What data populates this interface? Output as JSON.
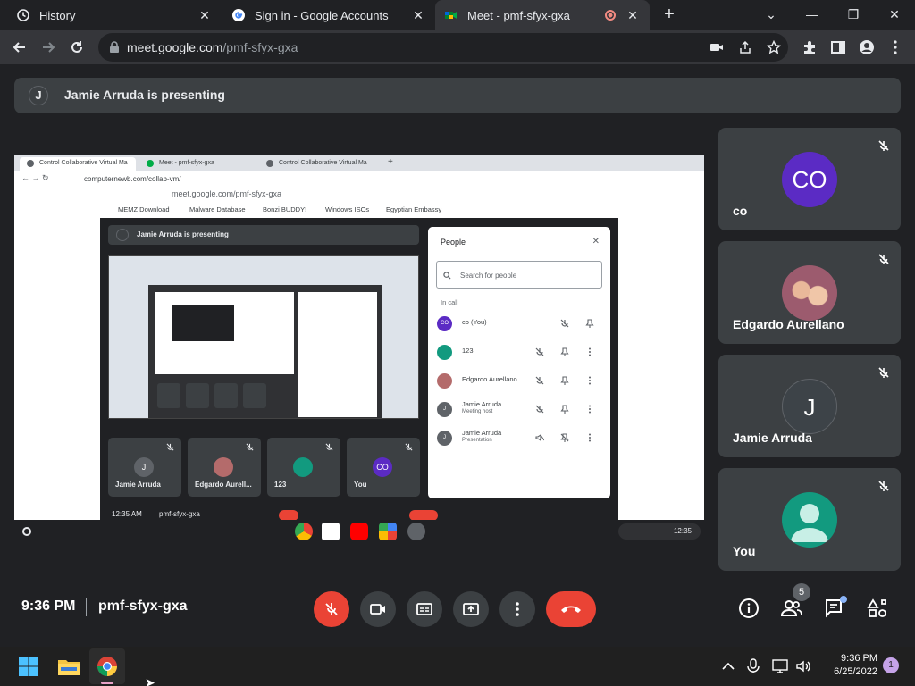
{
  "tabs": [
    {
      "label": "History"
    },
    {
      "label": "Sign in - Google Accounts"
    },
    {
      "label": "Meet - pmf-sfyx-gxa"
    }
  ],
  "address": {
    "host": "meet.google.com",
    "path": "/pmf-sfyx-gxa"
  },
  "meeting": {
    "presenter_initial": "J",
    "presenting_banner": "Jamie Arruda is presenting",
    "time": "9:36 PM",
    "code": "pmf-sfyx-gxa",
    "participant_count": "5"
  },
  "tiles": [
    {
      "name": "co",
      "avatar": "CO",
      "color": "#5b2bc4"
    },
    {
      "name": "Edgardo Aurellano",
      "avatar": "",
      "color": "#b46b6b"
    },
    {
      "name": "Jamie Arruda",
      "avatar": "J",
      "color": "#3c4043"
    },
    {
      "name": "You",
      "avatar": "",
      "color": "#129a7f"
    }
  ],
  "shared_screen": {
    "tabs": [
      "Control Collaborative Virtual Ma",
      "Meet - pmf-sfyx-gxa",
      "Control Collaborative Virtual Ma"
    ],
    "url": "computernewb.com/collab-vm/",
    "inner_url": "meet.google.com/pmf-sfyx-gxa",
    "bookmarks": [
      "MEMZ Download",
      "Malware Database",
      "Bonzi BUDDY!",
      "Windows ISOs",
      "Egyptian Embassy"
    ],
    "banner": "Jamie Arruda is presenting",
    "tiles": [
      {
        "name": "Jamie Arruda",
        "avatar": "J",
        "color": "#3c4043"
      },
      {
        "name": "Edgardo Aurell...",
        "avatar": "",
        "color": "#b46b6b"
      },
      {
        "name": "123",
        "avatar": "",
        "color": "#129a7f"
      },
      {
        "name": "You",
        "avatar": "CO",
        "color": "#5b2bc4"
      }
    ],
    "people": {
      "title": "People",
      "search_placeholder": "Search for people",
      "section": "In call",
      "rows": [
        {
          "name": "co (You)",
          "sub": "",
          "avatar": "CO",
          "color": "#5b2bc4"
        },
        {
          "name": "123",
          "sub": "",
          "avatar": "",
          "color": "#129a7f"
        },
        {
          "name": "Edgardo Aurellano",
          "sub": "",
          "avatar": "",
          "color": "#b46b6b"
        },
        {
          "name": "Jamie Arruda",
          "sub": "Meeting host",
          "avatar": "J",
          "color": "#5f6368"
        },
        {
          "name": "Jamie Arruda",
          "sub": "Presentation",
          "avatar": "J",
          "color": "#5f6368"
        }
      ]
    },
    "bottom_time": "12:35 AM",
    "bottom_code": "pmf-sfyx-gxa",
    "shelf_time": "12:35"
  },
  "taskbar": {
    "time": "9:36 PM",
    "date": "6/25/2022",
    "notifications": "1"
  }
}
